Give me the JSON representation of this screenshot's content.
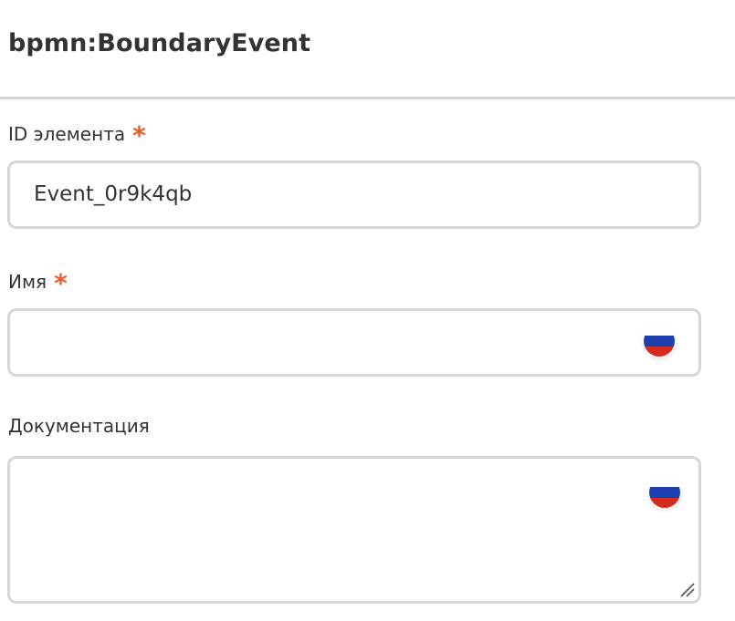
{
  "panel": {
    "title": "bpmn:BoundaryEvent"
  },
  "fields": {
    "element_id": {
      "label": "ID элемента",
      "required_mark": "*",
      "value": "Event_0r9k4qb"
    },
    "name": {
      "label": "Имя",
      "required_mark": "*",
      "value": "",
      "language_icon": "russia-flag-icon"
    },
    "documentation": {
      "label": "Документация",
      "value": "",
      "language_icon": "russia-flag-icon",
      "resize_icon": "resize-handle-icon"
    }
  },
  "colors": {
    "required": "#f05a23",
    "border": "#d6d6d6",
    "divider": "#d4d4d4",
    "text": "#333333",
    "flag_white": "#ffffff",
    "flag_blue": "#1c3fae",
    "flag_red": "#d52b1e"
  }
}
